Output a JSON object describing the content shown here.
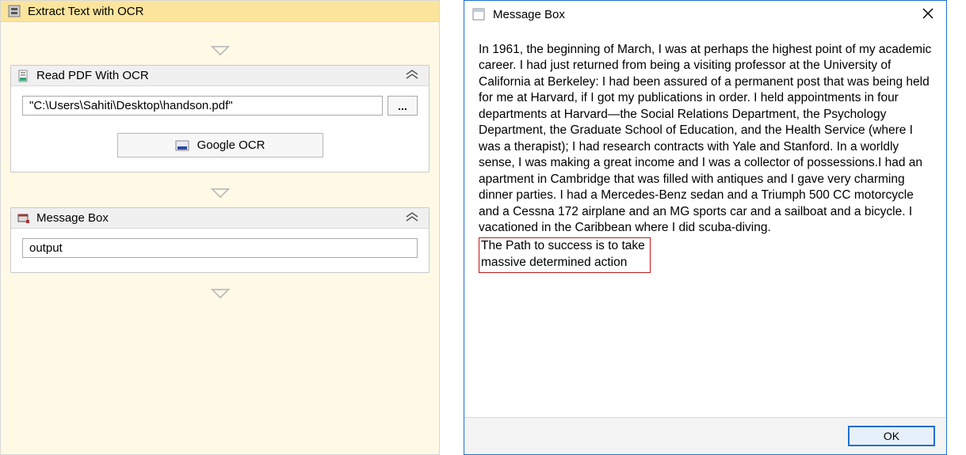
{
  "sequence": {
    "title": "Extract Text with OCR"
  },
  "readPdf": {
    "title": "Read PDF With OCR",
    "filePath": "\"C:\\Users\\Sahiti\\Desktop\\handson.pdf\"",
    "browse": "...",
    "engineLabel": "Google OCR"
  },
  "messageBoxActivity": {
    "title": "Message Box",
    "input": "output"
  },
  "dialog": {
    "title": "Message Box",
    "body": "In 1961, the beginning of March, I was at perhaps the highest point of my academic career. I had just returned from being a visiting professor at the University of California at Berkeley: I had been assured of a permanent post that was being held for me at Harvard, if I got my publications in order. I held appointments in four departments at Harvard—the Social Relations Department, the Psychology Department, the Graduate School of Education, and the Health Service (where I was a therapist); I had research contracts with Yale and Stanford. In a worldly sense, I was making a great income and I was a collector of possessions.I had an apartment in Cambridge that was filled with antiques and I gave very charming dinner parties. I had a Mercedes-Benz sedan and a Triumph 500 CC motorcycle and a Cessna 172 airplane and an MG sports car and a sailboat and a bicycle. I vacationed in the Caribbean where I did scuba-diving.",
    "highlight": "The Path to success is to take\nmassive determined action",
    "ok": "OK"
  }
}
